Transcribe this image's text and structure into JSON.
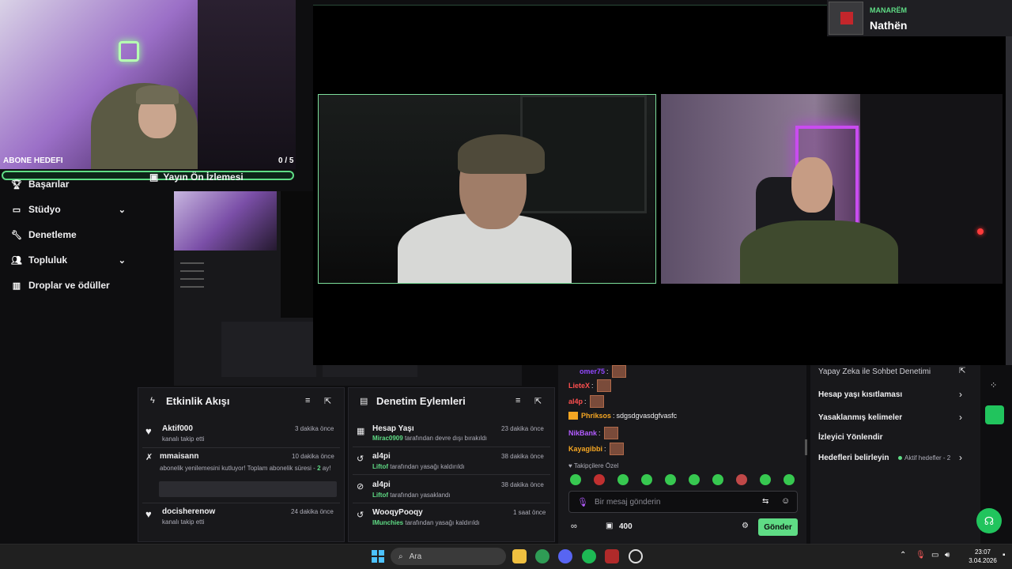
{
  "webcam": {
    "sub_goal_label": "ABONE HEDEFI",
    "sub_goal_count": "0 / 5",
    "sub_goal_fraction": 0
  },
  "preview": {
    "title": "Yayın Ön İzlemesi"
  },
  "sidebar": {
    "items": [
      {
        "label": "Başarılar",
        "icon": "trophy-icon"
      },
      {
        "label": "Stüdyo",
        "icon": "studio-icon",
        "expandable": true
      },
      {
        "label": "Denetleme",
        "icon": "wrench-icon"
      },
      {
        "label": "Topluluk",
        "icon": "community-icon",
        "expandable": true
      },
      {
        "label": "Droplar ve ödüller",
        "icon": "drops-icon"
      }
    ]
  },
  "alert": {
    "subtitle": "MANARËM",
    "name": "Nathën"
  },
  "activity_feed": {
    "title": "Etkinlik Akışı",
    "items": [
      {
        "name": "Aktif000",
        "text": "kanalı takip etti",
        "time": "3 dakika önce",
        "icon": "heart-icon"
      },
      {
        "name": "mmaisann",
        "text": "abonelik yenilemesini kutluyor! Toplam abonelik süresi -",
        "highlight": "2",
        "text_end": "ay!",
        "time": "10 dakika önce",
        "icon": "sub-icon"
      },
      {
        "name": "docisherenow",
        "text": "kanalı takip etti",
        "time": "24 dakika önce",
        "icon": "heart-icon"
      }
    ]
  },
  "mod_actions": {
    "title": "Denetim Eylemleri",
    "items": [
      {
        "name": "Hesap Yaşı",
        "user": "Mirac0909",
        "text": "tarafından devre dışı bırakıldı",
        "time": "23 dakika önce",
        "icon": "calendar-icon"
      },
      {
        "name": "al4pi",
        "user": "Liftof",
        "text": "tarafından yasağı kaldırıldı",
        "time": "38 dakika önce",
        "icon": "undo-icon"
      },
      {
        "name": "al4pi",
        "user": "Liftof",
        "text": "tarafından yasaklandı",
        "time": "38 dakika önce",
        "icon": "ban-icon"
      },
      {
        "name": "WooqyPooqy",
        "user": "IMunchies",
        "text": "tarafından yasağı kaldırıldı",
        "time": "1 saat önce",
        "icon": "undo-icon"
      }
    ]
  },
  "chat": {
    "messages": [
      {
        "user": "omer75",
        "color": "#9147ff",
        "text": ""
      },
      {
        "user": "LieteX",
        "color": "#ff4f4f",
        "text": ""
      },
      {
        "user": "al4p",
        "color": "#ff4f4f",
        "text": ""
      },
      {
        "user": "Phriksos",
        "color": "#f5a623",
        "text": "sdgsdgvasdgfvasfc"
      },
      {
        "user": "NikBank",
        "color": "#b35cff",
        "text": ""
      },
      {
        "user": "Kayagibbi",
        "color": "#f5a623",
        "text": ""
      }
    ],
    "followers_only": "Takipçilere Özel",
    "input_placeholder": "Bir mesaj gönderin",
    "points": "400",
    "send_label": "Gönder"
  },
  "mod_settings": {
    "items": [
      {
        "label": "Yapay Zeka ile Sohbet Denetimi",
        "action": "external"
      },
      {
        "label": "Hesap yaşı kısıtlaması",
        "action": "chevron"
      },
      {
        "label": "Yasaklanmış kelimeler",
        "action": "chevron"
      },
      {
        "label": "İzleyici Yönlendir",
        "action": "none"
      },
      {
        "label": "Hedefleri belirleyin",
        "action": "chevron",
        "extra": "Aktif hedefler - 2"
      }
    ]
  },
  "taskbar": {
    "search": "Ara",
    "time": "23:07",
    "date": "3.04.2026"
  },
  "colors": {
    "accent": "#5fdc85",
    "background": "#0e0e10",
    "panel": "#18181b"
  }
}
